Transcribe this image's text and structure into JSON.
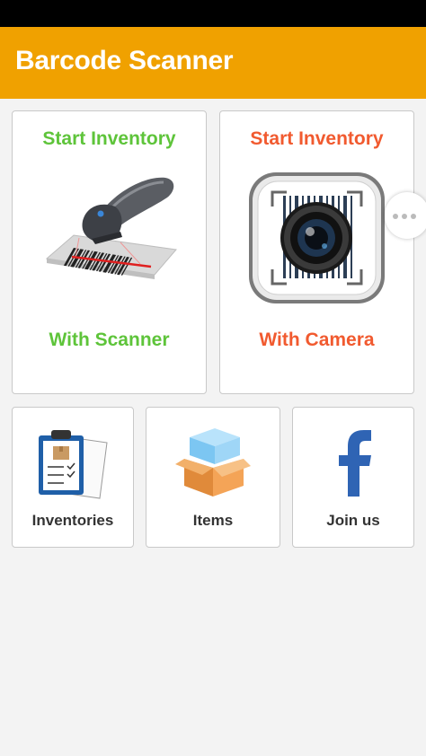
{
  "app": {
    "title": "Barcode Scanner"
  },
  "cards": {
    "scanner": {
      "line1": "Start Inventory",
      "line2": "With Scanner",
      "icon": "barcode-scanner-icon",
      "color": "#5ec43a"
    },
    "camera": {
      "line1": "Start Inventory",
      "line2": "With Camera",
      "icon": "camera-scan-icon",
      "color": "#f15a2f"
    },
    "inventories": {
      "label": "Inventories",
      "icon": "clipboard-icon"
    },
    "items": {
      "label": "Items",
      "icon": "box-icon"
    },
    "join": {
      "label": "Join us",
      "icon": "facebook-icon"
    }
  },
  "colors": {
    "app_bar": "#f0a100",
    "status_bar": "#000000",
    "background": "#f3f3f3"
  },
  "floating_button": {
    "icon": "more-dots-icon"
  }
}
